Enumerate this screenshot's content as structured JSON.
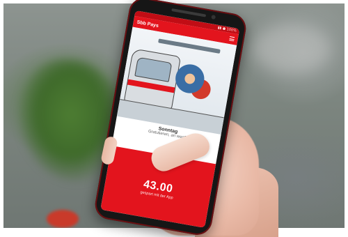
{
  "photo": {
    "subject": "hand-holding-smartphone",
    "background_colors": [
      "#7c857f",
      "#4d7d32",
      "#b0b3b1"
    ]
  },
  "app": {
    "accent_color": "#e3141d",
    "appbar_title": "Sbb Pays",
    "menu_icon": "hamburger-menu-icon",
    "status_text": "▮▮ ● 100%",
    "illustration": "cartoon-train-conductor-illustration",
    "caption_title": "Sonntag",
    "caption_subtitle": "Gratulieren, an wen?",
    "amount": "43.00",
    "amount_label": "gespart mit der App"
  }
}
